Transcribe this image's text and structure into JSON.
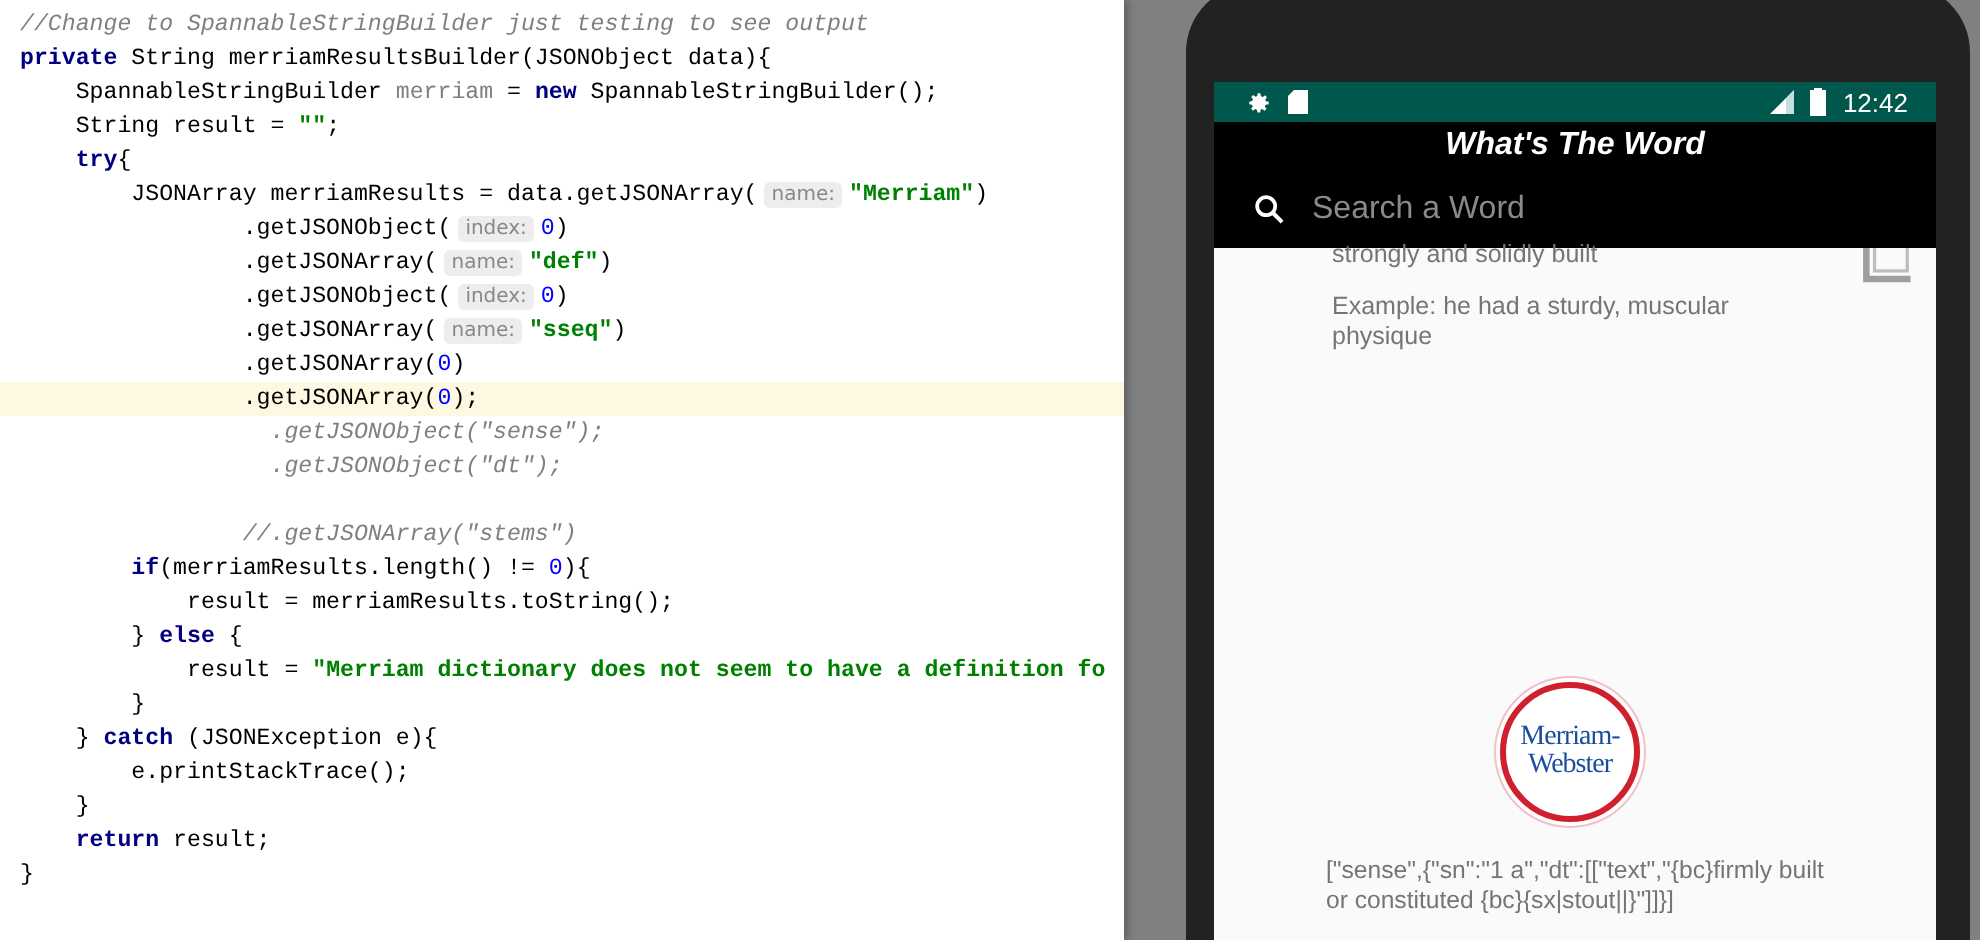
{
  "editor": {
    "lines": [
      {
        "current": false,
        "tokens": [
          {
            "kind": "comment",
            "text": "//Change to SpannableStringBuilder just testing to see output"
          }
        ]
      },
      {
        "current": false,
        "tokens": [
          {
            "kind": "keyword",
            "text": "private"
          },
          {
            "kind": "plain",
            "text": " String merriamResultsBuilder(JSONObject data){"
          }
        ]
      },
      {
        "current": false,
        "tokens": [
          {
            "kind": "plain",
            "text": "    SpannableStringBuilder "
          },
          {
            "kind": "unused",
            "text": "merriam"
          },
          {
            "kind": "plain",
            "text": " = "
          },
          {
            "kind": "keyword",
            "text": "new"
          },
          {
            "kind": "plain",
            "text": " SpannableStringBuilder();"
          }
        ]
      },
      {
        "current": false,
        "tokens": [
          {
            "kind": "plain",
            "text": "    String result = "
          },
          {
            "kind": "string",
            "text": "\"\""
          },
          {
            "kind": "plain",
            "text": ";"
          }
        ]
      },
      {
        "current": false,
        "tokens": [
          {
            "kind": "keyword",
            "text": "    try"
          },
          {
            "kind": "plain",
            "text": "{"
          }
        ]
      },
      {
        "current": false,
        "tokens": [
          {
            "kind": "plain",
            "text": "        JSONArray merriamResults = data.getJSONArray("
          },
          {
            "kind": "hint",
            "text": "name:"
          },
          {
            "kind": "string",
            "text": "\"Merriam\""
          },
          {
            "kind": "plain",
            "text": ")"
          }
        ]
      },
      {
        "current": false,
        "tokens": [
          {
            "kind": "plain",
            "text": "                .getJSONObject("
          },
          {
            "kind": "hint",
            "text": "index:"
          },
          {
            "kind": "number",
            "text": "0"
          },
          {
            "kind": "plain",
            "text": ")"
          }
        ]
      },
      {
        "current": false,
        "tokens": [
          {
            "kind": "plain",
            "text": "                .getJSONArray("
          },
          {
            "kind": "hint",
            "text": "name:"
          },
          {
            "kind": "string",
            "text": "\"def\""
          },
          {
            "kind": "plain",
            "text": ")"
          }
        ]
      },
      {
        "current": false,
        "tokens": [
          {
            "kind": "plain",
            "text": "                .getJSONObject("
          },
          {
            "kind": "hint",
            "text": "index:"
          },
          {
            "kind": "number",
            "text": "0"
          },
          {
            "kind": "plain",
            "text": ")"
          }
        ]
      },
      {
        "current": false,
        "tokens": [
          {
            "kind": "plain",
            "text": "                .getJSONArray("
          },
          {
            "kind": "hint",
            "text": "name:"
          },
          {
            "kind": "string",
            "text": "\"sseq\""
          },
          {
            "kind": "plain",
            "text": ")"
          }
        ]
      },
      {
        "current": false,
        "tokens": [
          {
            "kind": "plain",
            "text": "                .getJSONArray("
          },
          {
            "kind": "number",
            "text": "0"
          },
          {
            "kind": "plain",
            "text": ")"
          }
        ]
      },
      {
        "current": true,
        "tokens": [
          {
            "kind": "plain",
            "text": "                .getJSONArray("
          },
          {
            "kind": "number",
            "text": "0"
          },
          {
            "kind": "plain",
            "text": ");"
          }
        ]
      },
      {
        "current": false,
        "tokens": [
          {
            "kind": "dead",
            "text": "                  .getJSONObject(\"sense\");"
          }
        ]
      },
      {
        "current": false,
        "tokens": [
          {
            "kind": "dead",
            "text": "                  .getJSONObject(\"dt\");"
          }
        ]
      },
      {
        "current": false
      },
      {
        "current": false,
        "tokens": [
          {
            "kind": "comment",
            "text": "                //.getJSONArray(\"stems\")"
          }
        ]
      },
      {
        "current": false,
        "tokens": [
          {
            "kind": "keyword",
            "text": "        if"
          },
          {
            "kind": "plain",
            "text": "(merriamResults.length() != "
          },
          {
            "kind": "number",
            "text": "0"
          },
          {
            "kind": "plain",
            "text": "){"
          }
        ]
      },
      {
        "current": false,
        "tokens": [
          {
            "kind": "plain",
            "text": "            result = merriamResults.toString();"
          }
        ]
      },
      {
        "current": false,
        "tokens": [
          {
            "kind": "plain",
            "text": "        } "
          },
          {
            "kind": "keyword",
            "text": "else"
          },
          {
            "kind": "plain",
            "text": " {"
          }
        ]
      },
      {
        "current": false,
        "tokens": [
          {
            "kind": "plain",
            "text": "            result = "
          },
          {
            "kind": "string",
            "text": "\"Merriam dictionary does not seem to have a definition fo"
          }
        ]
      },
      {
        "current": false,
        "tokens": [
          {
            "kind": "plain",
            "text": "        }"
          }
        ]
      },
      {
        "current": false,
        "tokens": [
          {
            "kind": "plain",
            "text": "    } "
          },
          {
            "kind": "keyword",
            "text": "catch"
          },
          {
            "kind": "plain",
            "text": " (JSONException e){"
          }
        ]
      },
      {
        "current": false,
        "tokens": [
          {
            "kind": "plain",
            "text": "        e.printStackTrace();"
          }
        ]
      },
      {
        "current": false,
        "tokens": [
          {
            "kind": "plain",
            "text": "    }"
          }
        ]
      },
      {
        "current": false,
        "tokens": [
          {
            "kind": "keyword",
            "text": "    return"
          },
          {
            "kind": "plain",
            "text": " result;"
          }
        ]
      },
      {
        "current": false,
        "tokens": [
          {
            "kind": "plain",
            "text": "}"
          }
        ]
      }
    ]
  },
  "emulator": {
    "status_bar": {
      "time": "12:42"
    },
    "app_bar": {
      "title": "What's The Word"
    },
    "search": {
      "placeholder": "Search a Word"
    },
    "definition": {
      "text": "strongly and solidly built",
      "example": "Example: he had a sturdy, muscular physique"
    },
    "logo": {
      "line_1": "Merriam-",
      "line_2": "Webster"
    },
    "raw_output": "[\"sense\",{\"sn\":\"1 a\",\"dt\":[[\"text\",\"{bc}firmly built or constituted {bc}{sx|stout||}\"]]}]"
  }
}
